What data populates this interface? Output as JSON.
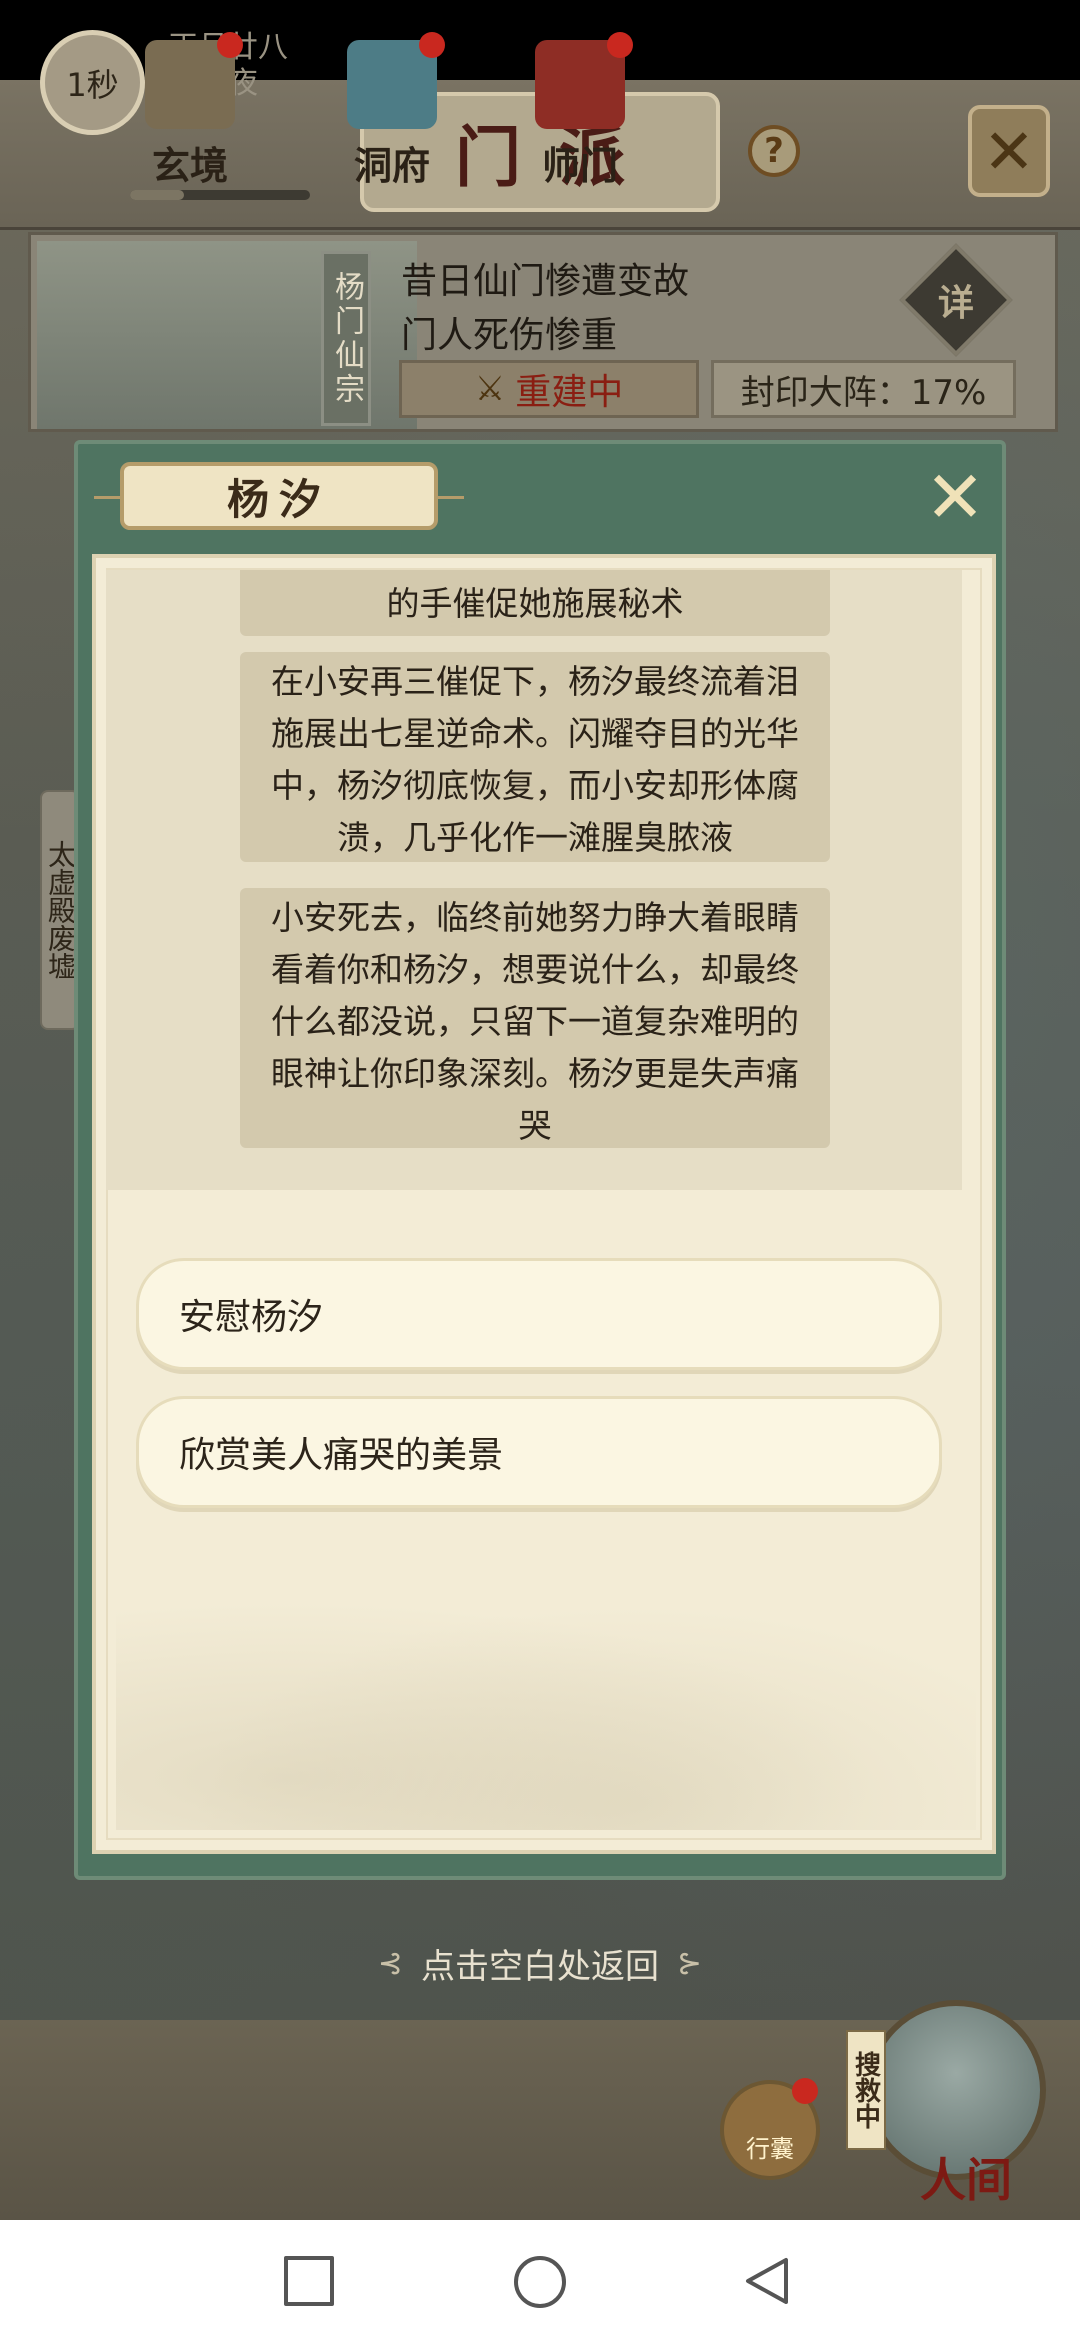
{
  "header": {
    "timer": "1秒",
    "date_line1": "正月廿八",
    "date_line2": "酉时夜",
    "title": "门派",
    "help": "?",
    "close": "✕"
  },
  "sect": {
    "name": "杨门仙宗",
    "desc_line1": "昔日仙门惨遭变故",
    "desc_line2": "门人死伤惨重",
    "detail_label": "详",
    "status": "重建中",
    "seal": "封印大阵：17%"
  },
  "side_tab": "太虚殿废墟",
  "modal": {
    "title": "杨汐",
    "close": "✕",
    "story": [
      "的手催促她施展秘术",
      "在小安再三催促下，杨汐最终流着泪施展出七星逆命术。闪耀夺目的光华中，杨汐彻底恢复，而小安却形体腐溃，几乎化作一滩腥臭脓液",
      "小安死去，临终前她努力睁大着眼睛看着你和杨汐，想要说什么，却最终什么都没说，只留下一道复杂难明的眼神让你印象深刻。杨汐更是失声痛哭"
    ],
    "choices": [
      "安慰杨汐",
      "欣赏美人痛哭的美景"
    ]
  },
  "hint": "点击空白处返回",
  "nav": {
    "items": [
      "玄境",
      "洞府",
      "师门"
    ],
    "bag": "行囊",
    "world": "人间",
    "search_tag": "搜救中"
  },
  "colors": {
    "modal_green": "#4f7461",
    "paper": "#f3ecd6",
    "status_red": "#8a1e12",
    "badge_red": "#c9281f"
  }
}
